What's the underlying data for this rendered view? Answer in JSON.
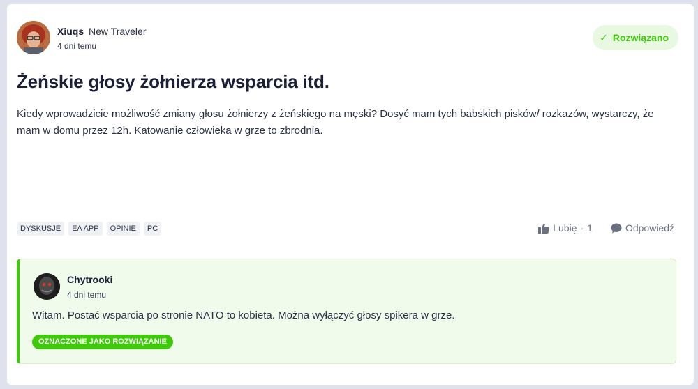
{
  "post": {
    "author": {
      "name": "Xiuqs",
      "rank": "New Traveler",
      "avatar_icon": "user-avatar"
    },
    "timestamp": "4 dni temu",
    "solved_label": "Rozwiązano",
    "title": "Żeńskie głosy żołnierza wsparcia itd.",
    "body": "Kiedy wprowadzicie możliwość zmiany głosu żołnierzy z żeńskiego na męski? Dosyć mam tych babskich pisków/ rozkazów, wystarczy, że mam w domu przez 12h. Katowanie człowieka w grze to zbrodnia.",
    "tags": [
      "Dyskusje",
      "EA App",
      "Opinie",
      "PC"
    ],
    "like_label": "Lubię",
    "like_count": "1",
    "reply_label": "Odpowiedź"
  },
  "answer": {
    "author": {
      "name": "Chytrooki",
      "avatar_icon": "user-avatar"
    },
    "timestamp": "4 dni temu",
    "body": "Witam. Postać wsparcia po stronie NATO to kobieta. Można wyłączyć głosy spikera w grze.",
    "badge": "Oznaczone jako rozwiązanie"
  },
  "colors": {
    "accent": "#3ec90b",
    "solved_bg": "#e9f9e1",
    "answer_bg": "#f1fbec",
    "page_bg": "#dfe1ec"
  }
}
